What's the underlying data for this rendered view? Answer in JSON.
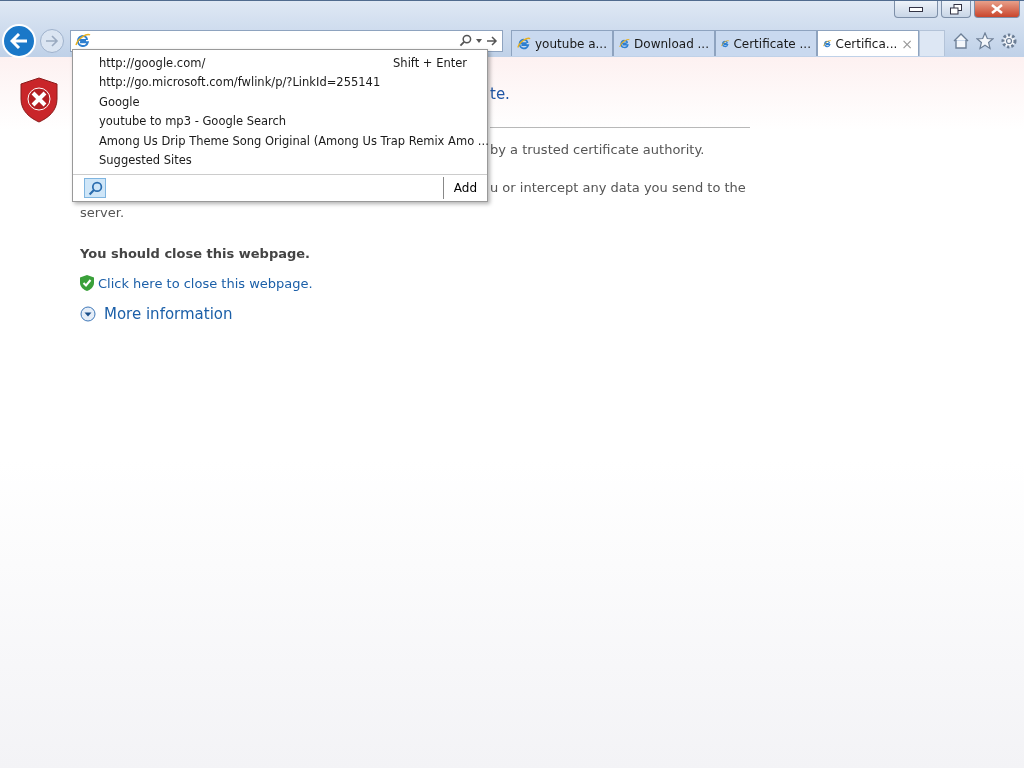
{
  "tabs": [
    {
      "label": "youtube a...",
      "selected": false
    },
    {
      "label": "Download ...",
      "selected": false
    },
    {
      "label": "Certificate ...",
      "selected": false
    },
    {
      "label": "Certifica...",
      "selected": true,
      "close": "×"
    }
  ],
  "page": {
    "heading_fragment": "te.",
    "line_1_fragment": "by a trusted certificate authority.",
    "line_2_fragment": "u or intercept any data you send to the",
    "line_3": "server.",
    "warning": "You should close this webpage.",
    "close_link": "Click here to close this webpage.",
    "more_info": "More information"
  },
  "suggestions": {
    "items": [
      {
        "text": "http://google.com/",
        "hint": "Shift + Enter"
      },
      {
        "text": "http://go.microsoft.com/fwlink/p/?LinkId=255141"
      },
      {
        "text": "Google"
      },
      {
        "text": "youtube to mp3 - Google Search"
      },
      {
        "text": "Among Us Drip Theme Song Original (Among Us Trap Remix Amo ..."
      },
      {
        "text": "Suggested Sites"
      }
    ],
    "add_button": "Add"
  }
}
